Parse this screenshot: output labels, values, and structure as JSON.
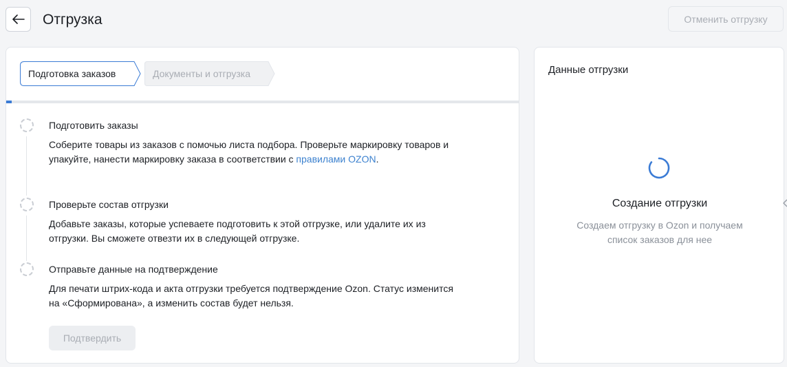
{
  "header": {
    "back_icon": "arrow-left-icon",
    "title": "Отгрузка",
    "cancel_label": "Отменить отгрузку"
  },
  "steps_nav": {
    "steps": [
      {
        "label": "Подготовка заказов",
        "state": "active"
      },
      {
        "label": "Документы и отгрузка",
        "state": "disabled"
      }
    ]
  },
  "tasks": [
    {
      "title": "Подготовить заказы",
      "desc_before": "Соберите товары из заказов с помочью листа подбора. Проверьте маркировку товаров и упакуйте, нанести маркировку заказа в соответствии с ",
      "link": "правилами OZON",
      "desc_after": "."
    },
    {
      "title": "Проверьте состав отгрузки",
      "desc": "Добавьте заказы, которые успеваете подготовить к этой отгрузке, или удалите их из отгрузки. Вы сможете отвезти их в следующей отгрузке."
    },
    {
      "title": "Отправьте данные на подтверждение",
      "desc": "Для печати штрих-кода и акта отгрузки требуется подтверждение Ozon. Статус изменится на «Сформирована», а изменить состав будет нельзя."
    }
  ],
  "confirm_label": "Подтвердить",
  "right_panel": {
    "title": "Данные отгрузки",
    "status_title": "Создание отгрузки",
    "status_desc": "Создаем отгрузку в Ozon и получаем список заказов для нее",
    "spinner_icon": "loading-spinner-icon"
  },
  "colors": {
    "accent": "#3a7bd5",
    "link": "#3d82cf",
    "muted": "#8a9099"
  }
}
